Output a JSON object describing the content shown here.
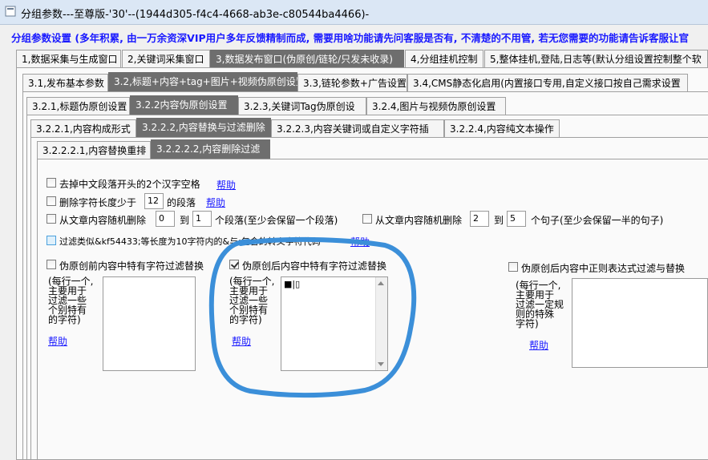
{
  "window": {
    "title": "分组参数---至尊版-'30'--(1944d305-f4c4-4668-ab3e-c80544ba4466)-"
  },
  "banner": "分组参数设置 (多年积累, 由一万余资深VIP用户多年反馈精制而成, 需要用啥功能请先问客服是否有, 不清楚的不用管, 若无您需要的功能请告诉客服让官",
  "tabs_l1": [
    {
      "label": "1,数据采集与生成窗口"
    },
    {
      "label": "2,关键词采集窗口"
    },
    {
      "label": "3,数据发布窗口(伪原创/链轮/只发未收录)"
    },
    {
      "label": "4,分组挂机控制"
    },
    {
      "label": "5,整体挂机,登陆,日志等(默认分组设置控制整个软"
    }
  ],
  "tabs_l2": [
    {
      "label": "3.1,发布基本参数"
    },
    {
      "label": "3.2,标题+内容+tag+图片+视频伪原创设置"
    },
    {
      "label": "3.3,链轮参数+广告设置"
    },
    {
      "label": "3.4,CMS静态化启用(内置接口专用,自定义接口按自己需求设置"
    }
  ],
  "tabs_l3": [
    {
      "label": "3.2.1,标题伪原创设置"
    },
    {
      "label": "3.2.2内容伪原创设置"
    },
    {
      "label": "3.2.3,关键词Tag伪原创设"
    },
    {
      "label": "3.2.4,图片与视频伪原创设置"
    }
  ],
  "tabs_l4": [
    {
      "label": "3.2.2.1,内容构成形式"
    },
    {
      "label": "3.2.2.2,内容替换与过滤删除"
    },
    {
      "label": "3.2.2.3,内容关键词或自定义字符插"
    },
    {
      "label": "3.2.2.4,内容纯文本操作"
    }
  ],
  "tabs_l5": [
    {
      "label": "3.2.2.2.1,内容替换重排"
    },
    {
      "label": "3.2.2.2.2,内容删除过滤"
    }
  ],
  "options": {
    "remove_indent": {
      "label": "去掉中文段落开头的2个汉字空格",
      "checked": false
    },
    "help": "帮助",
    "delete_short": {
      "label": "删除字符长度少于",
      "value": "12",
      "suffix": "的段落",
      "checked": false
    },
    "random_para": {
      "label": "从文章内容随机删除",
      "from": "0",
      "to_label": "到",
      "to": "1",
      "suffix": "个段落(至少会保留一个段落)",
      "checked": false
    },
    "random_sentence": {
      "label": "从文章内容随机删除",
      "from": "2",
      "to_label": "到",
      "to": "5",
      "suffix": "个句子(至少会保留一半的句子)",
      "checked": false
    },
    "filter_escape": {
      "label": "过滤类似&kf54433;等长度为10字符内的&与;包含的转义字符代码",
      "checked": false
    }
  },
  "filters": {
    "before": {
      "label": "伪原创前内容中特有字符过滤替换",
      "checked": false,
      "note": [
        "(每行一个,",
        "主要用于",
        "过滤一些",
        "个别特有",
        "的字符)"
      ],
      "content": ""
    },
    "after": {
      "label": "伪原创后内容中特有字符过滤替换",
      "checked": true,
      "note": [
        "(每行一个,",
        "主要用于",
        "过滤一些",
        "个别特有",
        "的字符)"
      ],
      "content": "■|▯"
    },
    "regex": {
      "label": "伪原创后内容中正则表达式过滤与替换",
      "checked": false,
      "note": [
        "(每行一个,",
        "主要用于",
        "过滤一定规",
        "则的特殊",
        "字符)"
      ],
      "content": ""
    }
  },
  "colors": {
    "banner": "#1a1aff",
    "active_tab": "#6e6e6e",
    "annotation": "#3b8fd9"
  }
}
